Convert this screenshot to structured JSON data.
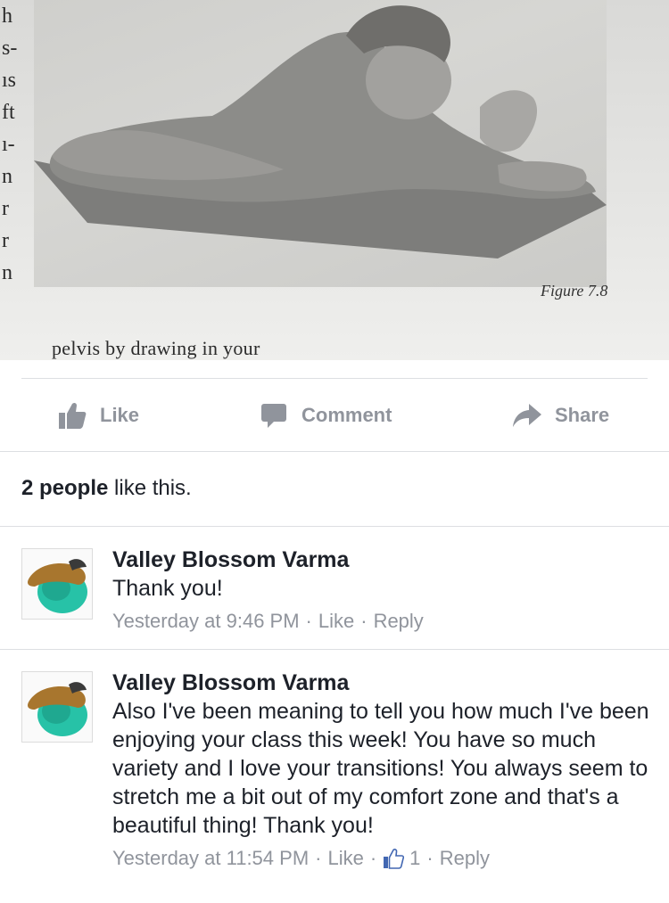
{
  "photo": {
    "edge_letters": [
      "h",
      "s-",
      "ıs",
      "ft",
      "ı-",
      "n",
      "r",
      "r",
      "n"
    ],
    "caption": "Figure 7.8",
    "bottom_text": "pelvis by drawing in your"
  },
  "actions": {
    "like_label": "Like",
    "comment_label": "Comment",
    "share_label": "Share"
  },
  "likes_summary": {
    "count_text": "2 people",
    "suffix": " like this."
  },
  "comments": [
    {
      "author": "Valley Blossom Varma",
      "text": "Thank you!",
      "timestamp": "Yesterday at 9:46 PM",
      "like_label": "Like",
      "reply_label": "Reply"
    },
    {
      "author": "Valley Blossom Varma",
      "text": "Also I've been meaning to tell you how much I've been enjoying your class this week! You have so much variety and I love your transitions! You always seem to stretch me a bit out of my comfort zone and that's a beautiful thing! Thank you!",
      "timestamp": "Yesterday at 11:54 PM",
      "like_label": "Like",
      "like_count": "1",
      "reply_label": "Reply"
    }
  ],
  "colors": {
    "meta_gray": "#90949c",
    "text": "#1d2129",
    "avatar_teal": "#27c2a7",
    "avatar_bronze": "#a8762e",
    "like_blue": "#4267b2"
  }
}
